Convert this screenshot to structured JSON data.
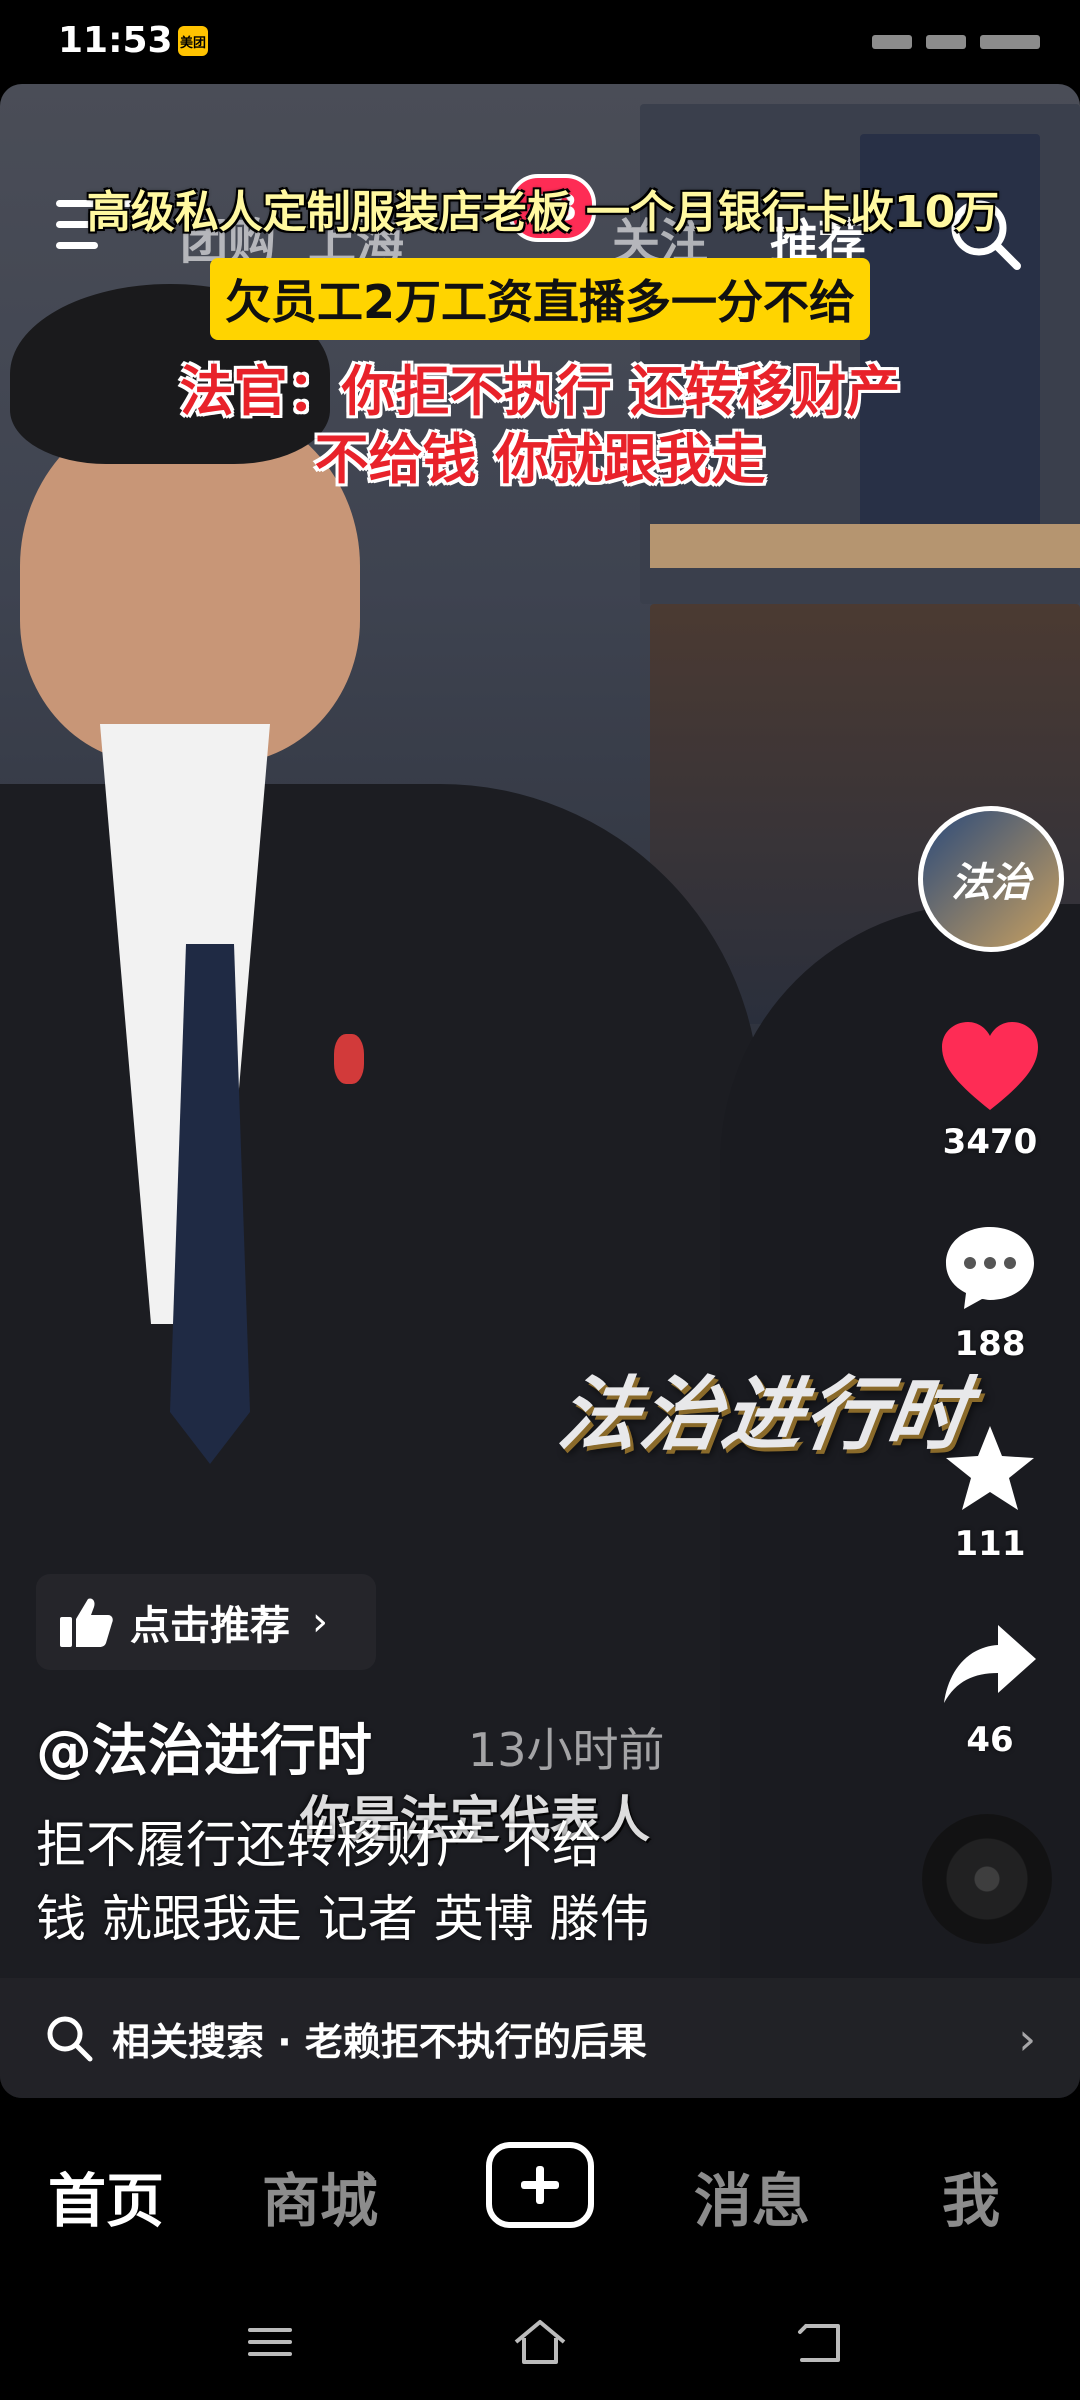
{
  "status_bar": {
    "time": "11:53",
    "app_badge": "美团"
  },
  "top_nav": {
    "tabs": [
      {
        "label": "团购",
        "active": false
      },
      {
        "label": "上海",
        "active": false
      },
      {
        "label": "关注",
        "active": false
      },
      {
        "label": "推荐",
        "active": true
      }
    ],
    "notification_count": "48"
  },
  "video": {
    "caption_title": "高级私人定制服装店老板 一个月银行卡收10万",
    "caption_yellow": "欠员工2万工资直播多一分不给",
    "caption_red_line1": "法官：你拒不执行 还转移财产",
    "caption_red_line2": "不给钱 你就跟我走",
    "watermark": "法治进行时",
    "subtitle": "你是法定代表人"
  },
  "right_rail": {
    "channel_avatar_text": "法治",
    "like_count": "3470",
    "comment_count": "188",
    "favorite_count": "111",
    "share_count": "46"
  },
  "recommend": {
    "label": "点击推荐"
  },
  "post": {
    "author": "@法治进行时",
    "time_ago": "13小时前",
    "description_line1": "拒不履行还转移财产 不给",
    "description_line2": "钱 就跟我走 记者 英博 滕伟"
  },
  "related_search": {
    "label": "相关搜索 · 老赖拒不执行的后果"
  },
  "bottom_nav": {
    "home": "首页",
    "mall": "商城",
    "messages": "消息",
    "me": "我"
  },
  "colors": {
    "like": "#fe2c55",
    "caption_yellow_bg": "#ffd400",
    "caption_red": "#e8222a"
  }
}
